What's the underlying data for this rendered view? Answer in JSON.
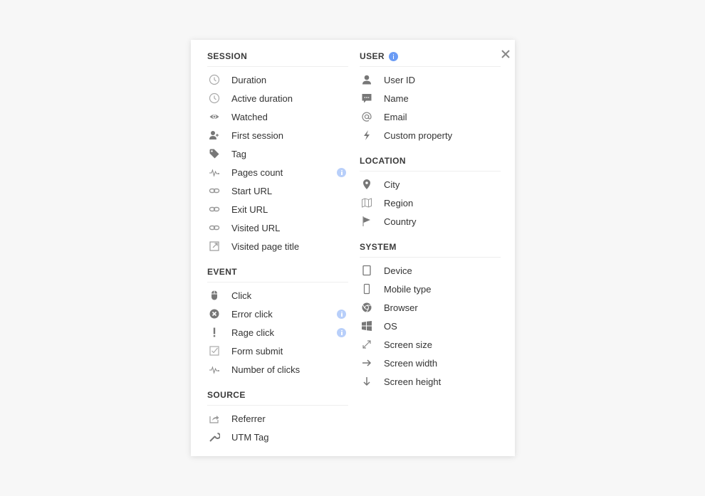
{
  "close_icon": "close-icon",
  "columns": {
    "left": [
      {
        "title": "SESSION",
        "items": [
          {
            "label": "Duration",
            "icon": "clock-icon"
          },
          {
            "label": "Active duration",
            "icon": "clock-icon"
          },
          {
            "label": "Watched",
            "icon": "eye-icon"
          },
          {
            "label": "First session",
            "icon": "person-add-icon"
          },
          {
            "label": "Tag",
            "icon": "tag-icon"
          },
          {
            "label": "Pages count",
            "icon": "pulse-icon",
            "info": true
          },
          {
            "label": "Start URL",
            "icon": "link-icon"
          },
          {
            "label": "Exit URL",
            "icon": "link-icon"
          },
          {
            "label": "Visited URL",
            "icon": "link-icon"
          },
          {
            "label": "Visited page title",
            "icon": "external-link-icon"
          }
        ]
      },
      {
        "title": "EVENT",
        "items": [
          {
            "label": "Click",
            "icon": "mouse-icon"
          },
          {
            "label": "Error click",
            "icon": "error-circle-icon",
            "info": true
          },
          {
            "label": "Rage click",
            "icon": "exclamation-icon",
            "info": true
          },
          {
            "label": "Form submit",
            "icon": "checkbox-icon"
          },
          {
            "label": "Number of clicks",
            "icon": "pulse-icon"
          }
        ]
      },
      {
        "title": "SOURCE",
        "items": [
          {
            "label": "Referrer",
            "icon": "share-icon"
          },
          {
            "label": "UTM Tag",
            "icon": "wrench-icon"
          }
        ]
      }
    ],
    "right": [
      {
        "title": "USER",
        "info": true,
        "items": [
          {
            "label": "User ID",
            "icon": "person-icon"
          },
          {
            "label": "Name",
            "icon": "comment-icon"
          },
          {
            "label": "Email",
            "icon": "at-icon"
          },
          {
            "label": "Custom property",
            "icon": "bolt-icon"
          }
        ]
      },
      {
        "title": "LOCATION",
        "items": [
          {
            "label": "City",
            "icon": "map-pin-icon"
          },
          {
            "label": "Region",
            "icon": "map-icon"
          },
          {
            "label": "Country",
            "icon": "flag-icon"
          }
        ]
      },
      {
        "title": "SYSTEM",
        "items": [
          {
            "label": "Device",
            "icon": "tablet-icon"
          },
          {
            "label": "Mobile type",
            "icon": "phone-icon"
          },
          {
            "label": "Browser",
            "icon": "chrome-icon"
          },
          {
            "label": "OS",
            "icon": "windows-icon"
          },
          {
            "label": "Screen size",
            "icon": "resize-icon"
          },
          {
            "label": "Screen width",
            "icon": "arrow-right-icon"
          },
          {
            "label": "Screen height",
            "icon": "arrow-down-icon"
          }
        ]
      }
    ]
  },
  "colors": {
    "info_badge_header": "#6b9cf5",
    "info_badge_row": "#b8cffa",
    "icon": "#7a7a7a",
    "text": "#333333"
  }
}
